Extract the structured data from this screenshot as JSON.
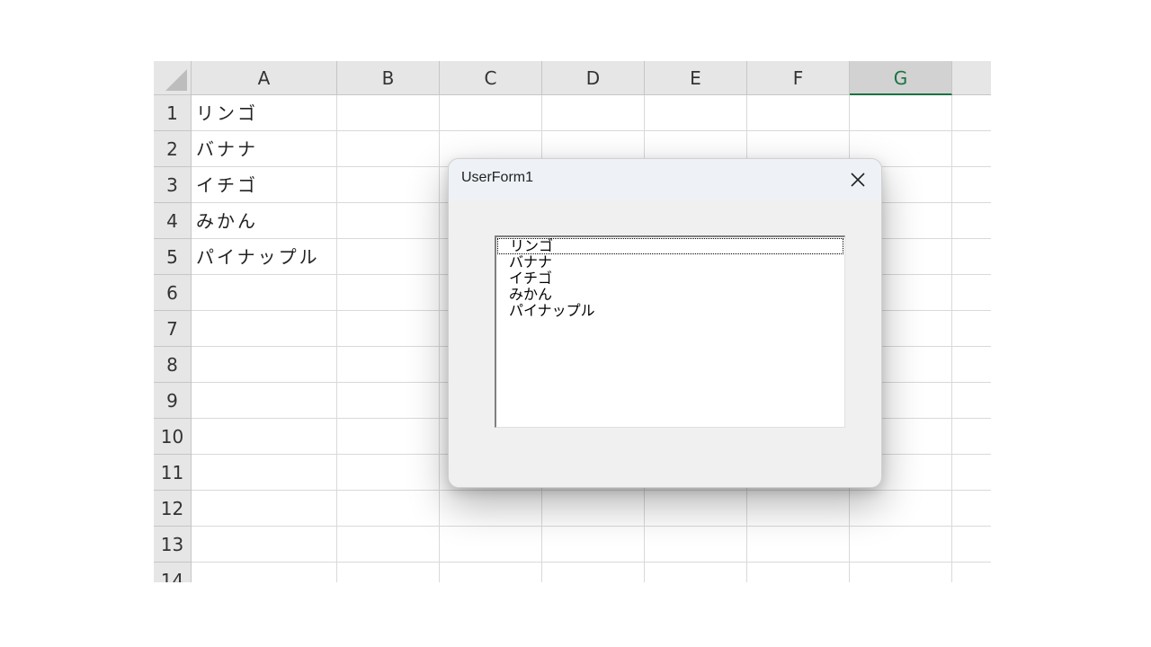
{
  "sheet": {
    "columns": [
      "A",
      "B",
      "C",
      "D",
      "E",
      "F",
      "G"
    ],
    "selected_column": "G",
    "rows": [
      "1",
      "2",
      "3",
      "4",
      "5",
      "6",
      "7",
      "8",
      "9",
      "10",
      "11",
      "12",
      "13",
      "14"
    ],
    "column_a_values": [
      "リンゴ",
      "バナナ",
      "イチゴ",
      "みかん",
      "パイナップル"
    ]
  },
  "dialog": {
    "title": "UserForm1",
    "close_icon": "close-icon",
    "listbox_items": [
      "リンゴ",
      "バナナ",
      "イチゴ",
      "みかん",
      "パイナップル"
    ],
    "focused_item_index": 0
  },
  "colors": {
    "selected_column_accent": "#1a7343"
  }
}
